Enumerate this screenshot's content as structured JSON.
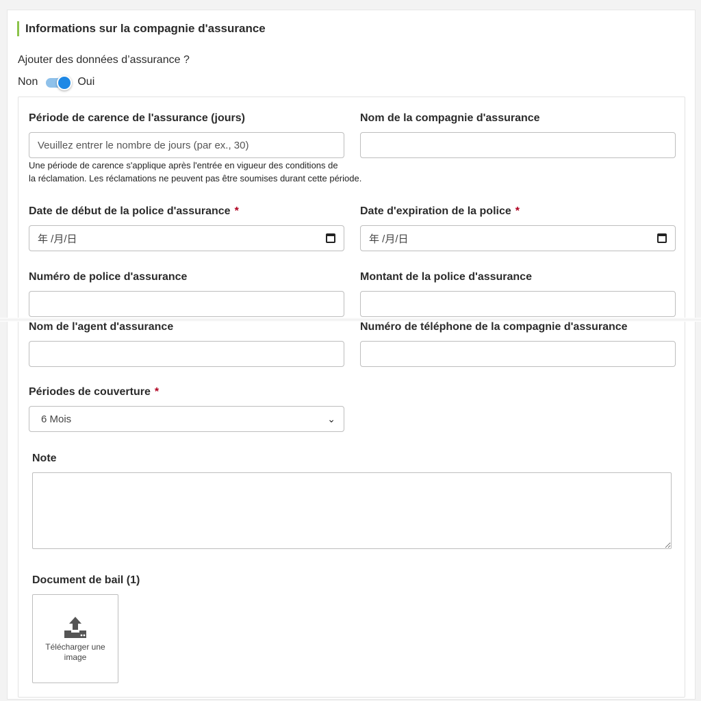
{
  "section": {
    "title": "Informations sur la compagnie d'assurance"
  },
  "toggle": {
    "question": "Ajouter des données d’assurance ?",
    "off_label": "Non",
    "on_label": "Oui",
    "state": "on"
  },
  "fields": {
    "grace_period": {
      "label": "Période de carence de l'assurance (jours)",
      "placeholder": "Veuillez entrer le nombre de jours (par ex., 30)",
      "help_line1": "Une période de carence s'applique après l'entrée en vigueur des conditions de",
      "help_line2": "la réclamation. Les réclamations ne peuvent pas être soumises durant cette période."
    },
    "company_name": {
      "label": "Nom de la compagnie d'assurance",
      "value": ""
    },
    "start_date": {
      "label": "Date de début de la police d'assurance",
      "required": "*",
      "value": "年 /月/日"
    },
    "expiry_date": {
      "label": "Date d'expiration de la police",
      "required": "*",
      "value": "年 /月/日"
    },
    "policy_number": {
      "label": "Numéro de police d'assurance",
      "value": ""
    },
    "policy_amount": {
      "label": "Montant de la police d'assurance",
      "value": ""
    },
    "agent_name": {
      "label": "Nom de l'agent d'assurance",
      "value": ""
    },
    "company_phone": {
      "label": "Numéro de téléphone de la compagnie d'assurance",
      "value": ""
    },
    "coverage": {
      "label": "Périodes de couverture",
      "required": "*",
      "selected": "6 Mois"
    },
    "note": {
      "label": "Note",
      "value": ""
    },
    "lease_doc": {
      "label": "Document de bail (1)",
      "upload_text": "Télécharger une image"
    }
  },
  "colors": {
    "accent_bar": "#8bc34a",
    "toggle": "#1e88e5",
    "required": "#b00020"
  },
  "icons": {
    "date": "calendar-icon",
    "select": "chevron-down-icon",
    "upload": "upload-icon"
  }
}
